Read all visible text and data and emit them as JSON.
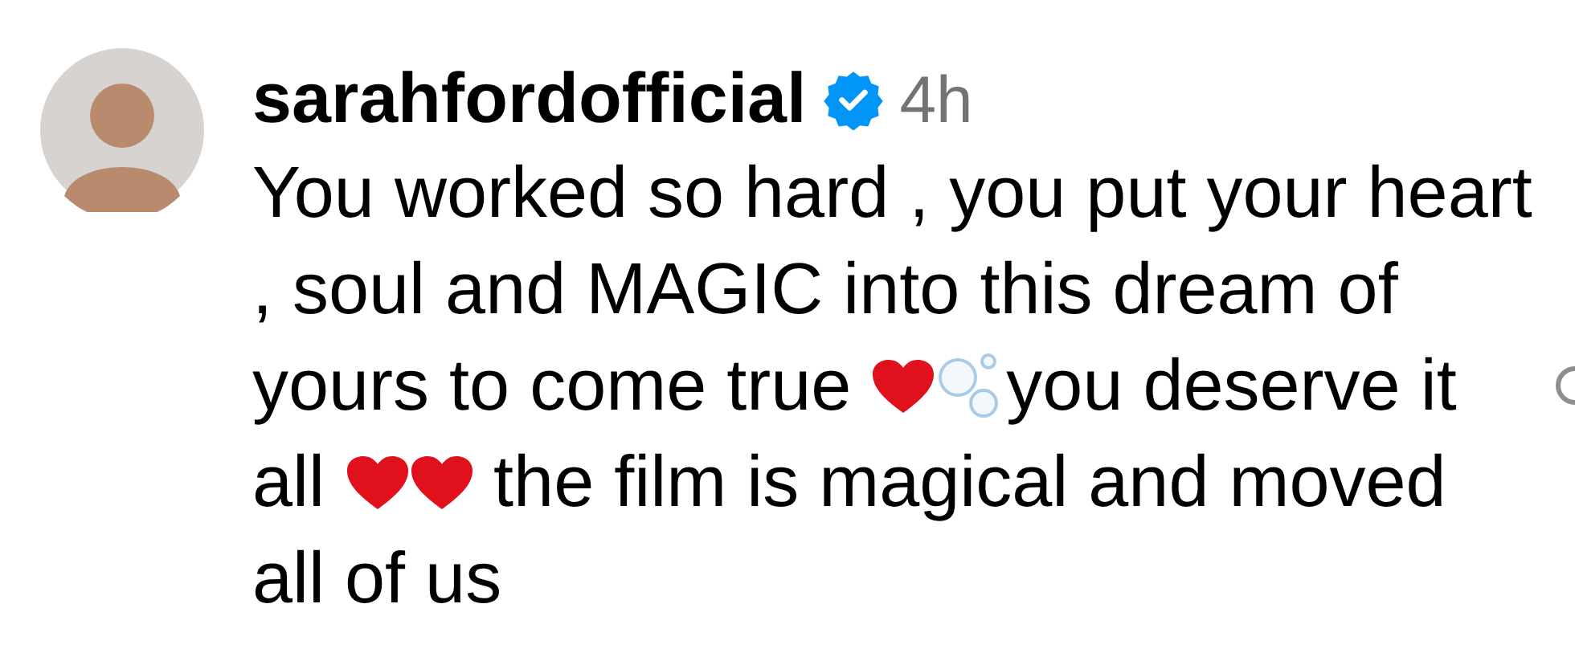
{
  "comment": {
    "username": "sarahfordofficial",
    "verified": true,
    "time": "4h",
    "body": [
      {
        "kind": "text",
        "text": "You worked so hard , you put your heart , soul and MAGIC into this dream of yours to come true "
      },
      {
        "kind": "heart"
      },
      {
        "kind": "bubbles"
      },
      {
        "kind": "text",
        "text": "you deserve it all "
      },
      {
        "kind": "heart"
      },
      {
        "kind": "heart"
      },
      {
        "kind": "text",
        "text": " the film is magical and moved all of us"
      }
    ]
  }
}
